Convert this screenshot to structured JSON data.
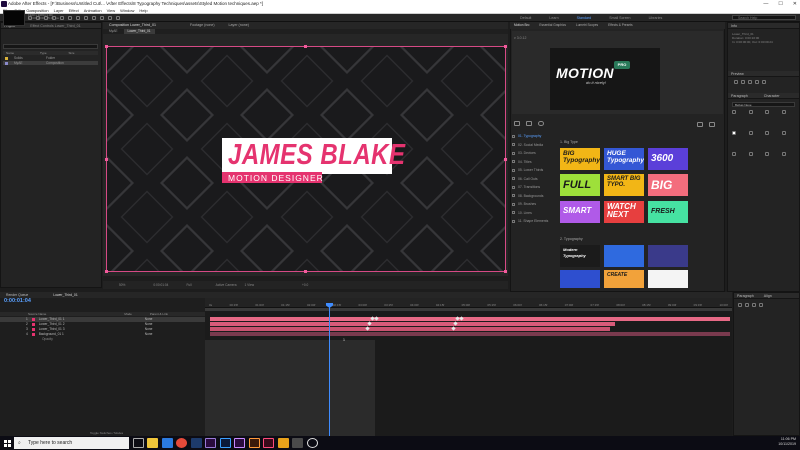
{
  "window": {
    "title": "Adobe After Effects - [F:\\Business\\Untitled Cut\\... \\After Effects\\8 Typography Techniques\\assets\\Styled Motion techniques.aep *]",
    "minimize": "—",
    "maximize": "☐",
    "close": "✕"
  },
  "menu": [
    "File",
    "Edit",
    "Composition",
    "Layer",
    "Effect",
    "Animation",
    "View",
    "Window",
    "Help"
  ],
  "workspaces": [
    "Default",
    "Learn",
    "Standard",
    "Small Screen",
    "Libraries"
  ],
  "search_help": "Search Help",
  "project": {
    "tab": "Project",
    "comp_name": "Effect Controls Lower_Third_01",
    "info": [
      "Null1",
      "1920 x 1080 (1.00)",
      "Δ 0:00:10:00, 25.00 fps"
    ],
    "columns": [
      "Name",
      "Type",
      "Size"
    ],
    "items": [
      {
        "name": "Solids",
        "type": "Folder",
        "color": "#d9b23a"
      },
      {
        "name": "MyAE",
        "type": "Composition",
        "color": "#8a8acb"
      }
    ]
  },
  "composition": {
    "tabs": [
      "Composition Lower_Third_01",
      "Footage (none)",
      "Layer (none)"
    ],
    "subtabs": [
      "MyAE",
      "Lower_Third_01"
    ],
    "active_subtab": "Lower_Third_01",
    "controls": [
      "50%",
      "0:00:01:04",
      "Full",
      "Active Camera",
      "1 View",
      "+0.0"
    ]
  },
  "lower_third": {
    "name": "JAMES BLAKE",
    "role": "MOTION DESIGNER",
    "accent": "#e5336f"
  },
  "motion": {
    "tabs": [
      "Motion Bro",
      "Essential Graphics",
      "Lumetri Scopes",
      "Effects & Presets"
    ],
    "version": "v 3.0.12",
    "logo": "MOTION",
    "pro": "PRO",
    "tagline": "do it nicely!",
    "categories": [
      "01. Typography",
      "02. Social Media",
      "03. Devices",
      "04. Titles",
      "05. Lower Thirds",
      "06. Call Outs",
      "07. Transitions",
      "08. Backgrounds",
      "09. Brushes",
      "10. Lines",
      "11. Shape Elements"
    ],
    "active_category": "01. Typography",
    "section_big": "1. Big Type",
    "section_typo": "2. Typography",
    "presets_row1": [
      {
        "text": "BIG Typography",
        "bg": "#f2b616",
        "fg": "#1a1a1a"
      },
      {
        "text": "HUGE Typography",
        "bg": "#3457d5",
        "fg": "#ffffff"
      },
      {
        "text": "3600",
        "bg": "#5b3fd9",
        "fg": "#ffffff"
      }
    ],
    "presets_row2": [
      {
        "text": "FULL",
        "bg": "#9ee03a",
        "fg": "#1a1a1a"
      },
      {
        "text": "SMART BIG TYPO.",
        "bg": "#f2b616",
        "fg": "#1a1a1a"
      },
      {
        "text": "BIG",
        "bg": "#f36d7d",
        "fg": "#ffffff"
      }
    ],
    "presets_row3": [
      {
        "text": "SMART",
        "bg": "#b05ae8",
        "fg": "#ffffff"
      },
      {
        "text": "WATCH NEXT",
        "bg": "#e73f3f",
        "fg": "#ffffff"
      },
      {
        "text": "FRESH",
        "bg": "#46e2a2",
        "fg": "#1a1a1a"
      }
    ],
    "presets_row4": [
      {
        "text": "Modern Typography",
        "bg": "#1b1b1b",
        "fg": "#ffffff"
      },
      {
        "text": "",
        "bg": "#2f6adf",
        "fg": "#ffffff"
      },
      {
        "text": "",
        "bg": "#3a3a8a",
        "fg": "#ffffff"
      }
    ],
    "presets_row5": [
      {
        "text": "",
        "bg": "#2e4fcf",
        "fg": "#ffffff"
      },
      {
        "text": "CREATE",
        "bg": "#f2a23a",
        "fg": "#1a1a1a"
      },
      {
        "text": "",
        "bg": "#f4f4f4",
        "fg": "#1a1a1a"
      }
    ]
  },
  "right_panel": {
    "info_tab": "Info",
    "preview_tab": "Preview",
    "character_tab": "Character",
    "paragraph_tab": "Paragraph",
    "font": "Bebas Neue",
    "info_lines": [
      "Lower_Third_01",
      "Duration: 0:00:10:00",
      "In: 0:00:00:00, Out: 0:00:09:24"
    ]
  },
  "timeline": {
    "tab": "Render Queue",
    "comp_tab": "Lower_Third_01",
    "time": "0:00:01:04",
    "columns": [
      "Source Name",
      "Mode",
      "Parent & Link"
    ],
    "layers": [
      {
        "index": "1",
        "name": "Lower_Third_01 1",
        "color": "#e5336f",
        "mode": "None"
      },
      {
        "index": "2",
        "name": "Lower_Third_01 2",
        "color": "#e5336f",
        "mode": "None"
      },
      {
        "index": "3",
        "name": "Lower_Third_01 3",
        "color": "#e5336f",
        "mode": "None"
      },
      {
        "index": "4",
        "name": "Background_01 1",
        "color": "#e5336f",
        "mode": "None"
      }
    ],
    "sub_row": "Opacity",
    "ruler": [
      "0s",
      "00:15f",
      "01:00f",
      "01:15f",
      "02:00f",
      "02:15f",
      "03:00f",
      "03:15f",
      "04:00f",
      "04:15f",
      "05:00f",
      "05:15f",
      "06:00f",
      "06:15f",
      "07:00f",
      "07:15f",
      "08:00f",
      "08:15f",
      "09:00f",
      "09:15f",
      "10:00f"
    ],
    "footer": "Toggle Switches / Modes",
    "marker": "1",
    "paragraph_tab": "Paragraph",
    "align_tab": "Align"
  },
  "taskbar": {
    "search": "Type here to search",
    "time": "11:06 PM",
    "date": "10/11/2019"
  }
}
